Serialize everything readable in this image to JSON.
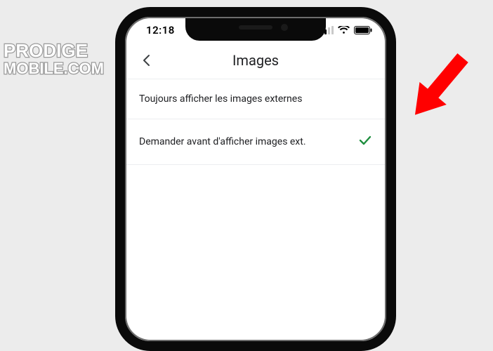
{
  "statusbar": {
    "time": "12:18"
  },
  "nav": {
    "title": "Images"
  },
  "options": {
    "always_show": {
      "label": "Toujours afficher les images externes",
      "selected": false
    },
    "ask_before": {
      "label": "Demander avant d'afficher images ext.",
      "selected": true
    }
  },
  "watermark": {
    "line1": "PRODIGE",
    "line2": "MOBILE.COM"
  }
}
